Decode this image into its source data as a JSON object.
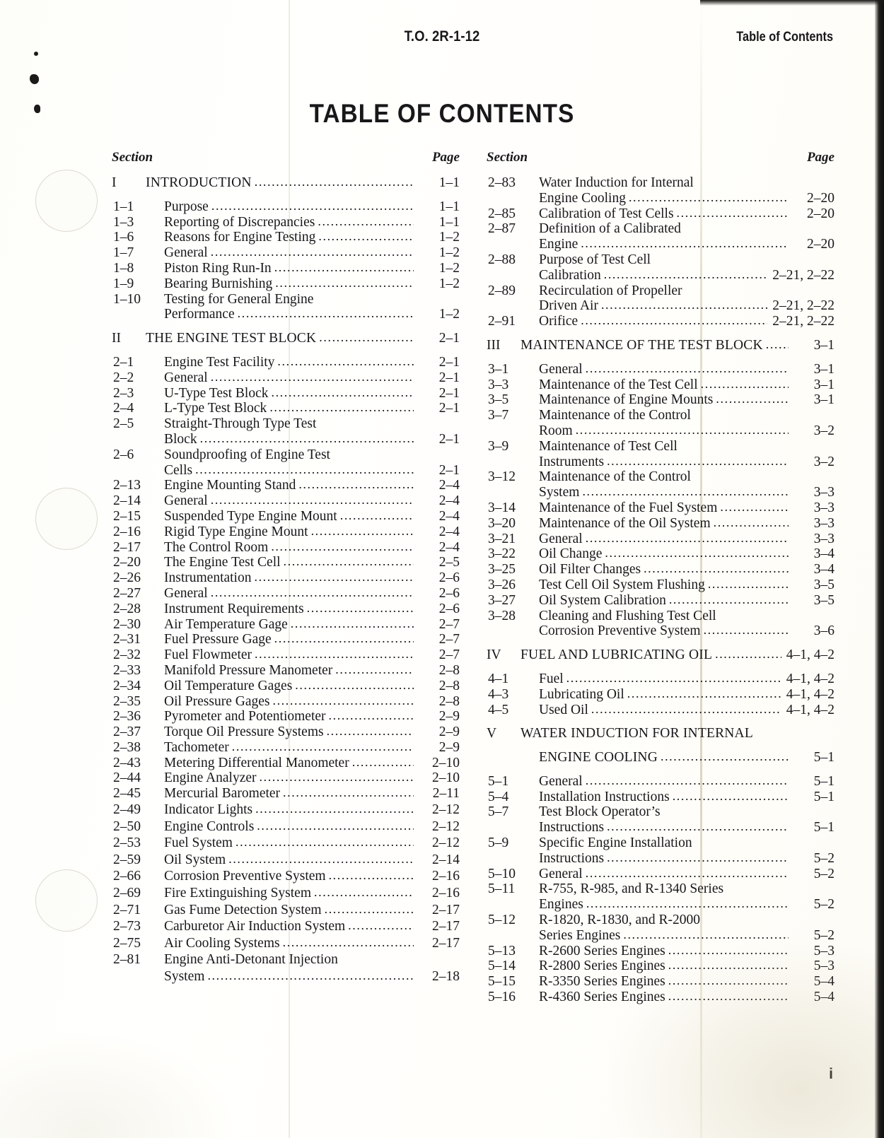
{
  "header": {
    "doc_number": "T.O. 2R-1-12",
    "running_head_right": "Table of Contents",
    "title": "TABLE OF CONTENTS"
  },
  "column_headers": {
    "section": "Section",
    "page": "Page"
  },
  "folio": "i",
  "left_column": [
    {
      "kind": "section",
      "num": "I",
      "title": "INTRODUCTION",
      "page": "1–1"
    },
    {
      "kind": "item",
      "num": "1–1",
      "title": "Purpose",
      "page": "1–1"
    },
    {
      "kind": "item",
      "num": "1–3",
      "title": "Reporting of Discrepancies",
      "page": "1–1"
    },
    {
      "kind": "item",
      "num": "1–6",
      "title": "Reasons for Engine Testing",
      "page": "1–2"
    },
    {
      "kind": "item",
      "num": "1–7",
      "title": "General",
      "page": "1–2"
    },
    {
      "kind": "item",
      "num": "1–8",
      "title": "Piston Ring Run-In",
      "page": "1–2"
    },
    {
      "kind": "item",
      "num": "1–9",
      "title": "Bearing Burnishing",
      "page": "1–2"
    },
    {
      "kind": "item-wrap",
      "num": "1–10",
      "title": "Testing for General Engine",
      "title2": "Performance",
      "page": "1–2"
    },
    {
      "kind": "section",
      "num": "II",
      "title": "THE ENGINE TEST BLOCK",
      "page": "2–1"
    },
    {
      "kind": "item",
      "num": "2–1",
      "title": "Engine Test Facility",
      "page": "2–1"
    },
    {
      "kind": "item",
      "num": "2–2",
      "title": "General",
      "page": "2–1"
    },
    {
      "kind": "item",
      "num": "2–3",
      "title": "U-Type Test Block",
      "page": "2–1"
    },
    {
      "kind": "item",
      "num": "2–4",
      "title": "L-Type Test Block",
      "page": "2–1"
    },
    {
      "kind": "item-wrap",
      "num": "2–5",
      "title": "Straight-Through Type Test",
      "title2": "Block",
      "page": "2–1"
    },
    {
      "kind": "item-wrap",
      "num": "2–6",
      "title": "Soundproofing of Engine Test",
      "title2": "Cells",
      "page": "2–1"
    },
    {
      "kind": "item",
      "num": "2–13",
      "title": "Engine Mounting Stand",
      "page": "2–4"
    },
    {
      "kind": "item",
      "num": "2–14",
      "title": "General",
      "page": "2–4"
    },
    {
      "kind": "item",
      "num": "2–15",
      "title": "Suspended Type Engine Mount",
      "page": "2–4"
    },
    {
      "kind": "item",
      "num": "2–16",
      "title": "Rigid Type Engine Mount",
      "page": "2–4"
    },
    {
      "kind": "item",
      "num": "2–17",
      "title": "The Control Room",
      "page": "2–4"
    },
    {
      "kind": "item",
      "num": "2–20",
      "title": "The Engine Test Cell",
      "page": "2–5"
    },
    {
      "kind": "item",
      "num": "2–26",
      "title": "Instrumentation",
      "page": "2–6"
    },
    {
      "kind": "item",
      "num": "2–27",
      "title": "General",
      "page": "2–6"
    },
    {
      "kind": "item",
      "num": "2–28",
      "title": "Instrument Requirements",
      "page": "2–6"
    },
    {
      "kind": "item",
      "num": "2–30",
      "title": "Air Temperature Gage",
      "page": "2–7"
    },
    {
      "kind": "item",
      "num": "2–31",
      "title": "Fuel Pressure Gage",
      "page": "2–7"
    },
    {
      "kind": "item",
      "num": "2–32",
      "title": "Fuel Flowmeter",
      "page": "2–7"
    },
    {
      "kind": "item",
      "num": "2–33",
      "title": "Manifold Pressure Manometer",
      "page": "2–8"
    },
    {
      "kind": "item",
      "num": "2–34",
      "title": "Oil Temperature Gages",
      "page": "2–8"
    },
    {
      "kind": "item",
      "num": "2–35",
      "title": "Oil Pressure Gages",
      "page": "2–8"
    },
    {
      "kind": "item",
      "num": "2–36",
      "title": "Pyrometer and Potentiometer",
      "page": "2–9"
    },
    {
      "kind": "item",
      "num": "2–37",
      "title": "Torque Oil Pressure Systems",
      "page": "2–9"
    },
    {
      "kind": "item",
      "num": "2–38",
      "title": "Tachometer",
      "page": "2–9"
    },
    {
      "kind": "item",
      "num": "2–43",
      "title": "Metering Differential Manometer",
      "page": "2–10"
    },
    {
      "kind": "item",
      "num": "2–44",
      "title": "Engine Analyzer",
      "page": "2–10"
    },
    {
      "kind": "item",
      "num": "2–45",
      "title": "Mercurial Barometer",
      "page": "2–11"
    },
    {
      "kind": "item-loose",
      "num": "2–49",
      "title": "Indicator Lights",
      "page": "2–12"
    },
    {
      "kind": "item-loose",
      "num": "2–50",
      "title": "Engine Controls",
      "page": "2–12"
    },
    {
      "kind": "item-loose",
      "num": "2–53",
      "title": "Fuel System",
      "page": "2–12"
    },
    {
      "kind": "item-loose",
      "num": "2–59",
      "title": "Oil System",
      "page": "2–14"
    },
    {
      "kind": "item-loose",
      "num": "2–66",
      "title": "Corrosion Preventive System",
      "page": "2–16"
    },
    {
      "kind": "item-loose",
      "num": "2–69",
      "title": "Fire Extinguishing System",
      "page": "2–16"
    },
    {
      "kind": "item-loose",
      "num": "2–71",
      "title": "Gas Fume Detection System",
      "page": "2–17"
    },
    {
      "kind": "item-loose",
      "num": "2–73",
      "title": "Carburetor Air Induction System",
      "page": "2–17"
    },
    {
      "kind": "item-loose",
      "num": "2–75",
      "title": "Air Cooling Systems",
      "page": "2–17"
    },
    {
      "kind": "item-wrap-loose",
      "num": "2–81",
      "title": "Engine Anti-Detonant Injection",
      "title2": "System",
      "page": "2–18"
    }
  ],
  "right_column": [
    {
      "kind": "item-wrap",
      "num": "2–83",
      "title": "Water Induction for Internal",
      "title2": "Engine Cooling",
      "page": "2–20"
    },
    {
      "kind": "item",
      "num": "2–85",
      "title": "Calibration of Test Cells",
      "page": "2–20"
    },
    {
      "kind": "item-wrap",
      "num": "2–87",
      "title": "Definition of a Calibrated",
      "title2": "Engine",
      "page": "2–20"
    },
    {
      "kind": "item-wrap",
      "num": "2–88",
      "title": "Purpose of Test Cell",
      "title2": "Calibration",
      "page": "2–21, 2–22"
    },
    {
      "kind": "item-wrap",
      "num": "2–89",
      "title": "Recirculation of Propeller",
      "title2": "Driven Air",
      "page": "2–21, 2–22"
    },
    {
      "kind": "item",
      "num": "2–91",
      "title": "Orifice",
      "page": "2–21, 2–22"
    },
    {
      "kind": "section",
      "num": "III",
      "title": "MAINTENANCE OF THE TEST BLOCK",
      "page": "3–1"
    },
    {
      "kind": "item",
      "num": "3–1",
      "title": "General",
      "page": "3–1"
    },
    {
      "kind": "item",
      "num": "3–3",
      "title": "Maintenance of the Test Cell",
      "page": "3–1"
    },
    {
      "kind": "item",
      "num": "3–5",
      "title": "Maintenance of Engine Mounts",
      "page": "3–1"
    },
    {
      "kind": "item-wrap",
      "num": "3–7",
      "title": "Maintenance of the Control",
      "title2": "Room",
      "page": "3–2"
    },
    {
      "kind": "item-wrap",
      "num": "3–9",
      "title": "Maintenance of Test Cell",
      "title2": "Instruments",
      "page": "3–2"
    },
    {
      "kind": "item-wrap",
      "num": "3–12",
      "title": "Maintenance of the Control",
      "title2": "System",
      "page": "3–3"
    },
    {
      "kind": "item",
      "num": "3–14",
      "title": "Maintenance of the Fuel System",
      "page": "3–3"
    },
    {
      "kind": "item",
      "num": "3–20",
      "title": "Maintenance of the Oil System",
      "page": "3–3"
    },
    {
      "kind": "item",
      "num": "3–21",
      "title": "General",
      "page": "3–3"
    },
    {
      "kind": "item",
      "num": "3–22",
      "title": "Oil Change",
      "page": "3–4"
    },
    {
      "kind": "item",
      "num": "3–25",
      "title": "Oil Filter Changes",
      "page": "3–4"
    },
    {
      "kind": "item",
      "num": "3–26",
      "title": "Test Cell Oil System Flushing",
      "page": "3–5"
    },
    {
      "kind": "item",
      "num": "3–27",
      "title": "Oil System Calibration",
      "page": "3–5"
    },
    {
      "kind": "item-wrap",
      "num": "3–28",
      "title": "Cleaning and Flushing Test Cell",
      "title2": "Corrosion Preventive System",
      "page": "3–6"
    },
    {
      "kind": "section",
      "num": "IV",
      "title": "FUEL AND LUBRICATING OIL",
      "page": "4–1, 4–2"
    },
    {
      "kind": "item",
      "num": "4–1",
      "title": "Fuel",
      "page": "4–1, 4–2"
    },
    {
      "kind": "item",
      "num": "4–3",
      "title": "Lubricating Oil",
      "page": "4–1, 4–2"
    },
    {
      "kind": "item",
      "num": "4–5",
      "title": "Used Oil",
      "page": "4–1, 4–2"
    },
    {
      "kind": "section-wrap",
      "num": "V",
      "title": "WATER INDUCTION FOR INTERNAL",
      "title2": "ENGINE COOLING",
      "page": "5–1"
    },
    {
      "kind": "item",
      "num": "5–1",
      "title": "General",
      "page": "5–1"
    },
    {
      "kind": "item",
      "num": "5–4",
      "title": "Installation Instructions",
      "page": "5–1"
    },
    {
      "kind": "item-wrap",
      "num": "5–7",
      "title": "Test Block Operator’s",
      "title2": "Instructions",
      "page": "5–1"
    },
    {
      "kind": "item-wrap",
      "num": "5–9",
      "title": "Specific Engine Installation",
      "title2": "Instructions",
      "page": "5–2"
    },
    {
      "kind": "item",
      "num": "5–10",
      "title": "General",
      "page": "5–2"
    },
    {
      "kind": "item-wrap",
      "num": "5–11",
      "title": "R-755, R-985, and R-1340 Series",
      "title2": "Engines",
      "page": "5–2"
    },
    {
      "kind": "item-wrap",
      "num": "5–12",
      "title": "R-1820, R-1830, and R-2000",
      "title2": "Series Engines",
      "page": "5–2"
    },
    {
      "kind": "item",
      "num": "5–13",
      "title": "R-2600 Series Engines",
      "page": "5–3"
    },
    {
      "kind": "item",
      "num": "5–14",
      "title": "R-2800 Series Engines",
      "page": "5–3"
    },
    {
      "kind": "item",
      "num": "5–15",
      "title": "R-3350 Series Engines",
      "page": "5–4"
    },
    {
      "kind": "item",
      "num": "5–16",
      "title": "R-4360 Series Engines",
      "page": "5–4"
    }
  ]
}
